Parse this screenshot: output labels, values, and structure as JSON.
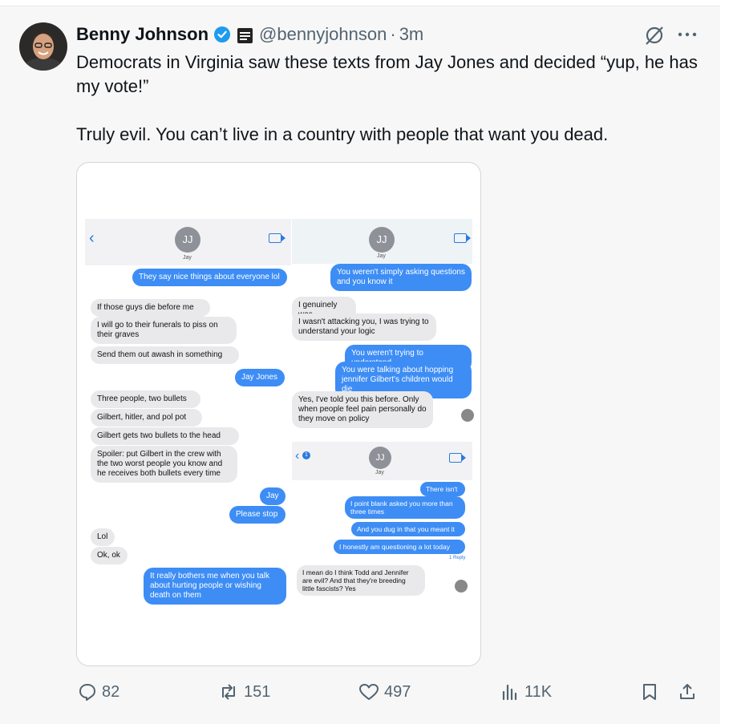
{
  "tweet": {
    "author_name": "Benny Johnson",
    "handle": "@bennyjohnson",
    "time": "3m",
    "dot": "·",
    "text_line1": "Democrats in Virginia saw these texts from Jay Jones and decided “yup, he has my vote!”",
    "text_line2": "Truly evil. You can’t live in a country with people that want you dead."
  },
  "media": {
    "left": {
      "contact_initials": "JJ",
      "contact_name": "Jay",
      "messages": [
        {
          "side": "me",
          "text": "They say nice things about everyone lol"
        },
        {
          "side": "them",
          "text": "If those guys die before me"
        },
        {
          "side": "them",
          "text": "I will go to their funerals to piss on their graves"
        },
        {
          "side": "them",
          "text": "Send them out awash in something"
        },
        {
          "side": "me",
          "text": "Jay Jones"
        },
        {
          "side": "them",
          "text": "Three people, two bullets"
        },
        {
          "side": "them",
          "text": "Gilbert, hitler, and pol pot"
        },
        {
          "side": "them",
          "text": "Gilbert gets two bullets to the head"
        },
        {
          "side": "them",
          "text": "Spoiler: put Gilbert in the crew with the two worst people you know and he receives both bullets every time"
        },
        {
          "side": "me",
          "text": "Jay"
        },
        {
          "side": "me",
          "text": "Please stop"
        },
        {
          "side": "them",
          "text": "Lol"
        },
        {
          "side": "them",
          "text": "Ok, ok"
        },
        {
          "side": "me",
          "text": "It really bothers me when you talk about hurting people or wishing death on them"
        }
      ]
    },
    "top_right": {
      "contact_initials": "JJ",
      "contact_name": "Jay",
      "messages": [
        {
          "side": "me",
          "text": "You weren't simply asking questions and you know it"
        },
        {
          "side": "them",
          "text": "I genuinely was"
        },
        {
          "side": "them",
          "text": "I wasn't attacking you, I was trying to understand your logic"
        },
        {
          "side": "me",
          "text": "You weren't trying to understand"
        },
        {
          "side": "me",
          "text": "You were talking about hopping jennifer Gilbert's children would die"
        },
        {
          "side": "them",
          "text": "Yes, I've told you this before. Only when people feel pain personally do they move on policy"
        }
      ]
    },
    "bottom_right": {
      "contact_initials": "JJ",
      "contact_name": "Jay",
      "back_count": "1",
      "messages": [
        {
          "side": "me",
          "text": "There isn't"
        },
        {
          "side": "me",
          "text": "I point blank asked you more than three times"
        },
        {
          "side": "me",
          "text": "And you dug in that you meant it"
        },
        {
          "side": "me",
          "text": "I honestly am questioning a lot today"
        },
        {
          "side": "them",
          "text": "I mean do I think Todd and Jennifer are evil? And that they're breeding little fascists? Yes"
        }
      ],
      "reply_label": "1 Reply"
    }
  },
  "actions": {
    "replies": "82",
    "reposts": "151",
    "likes": "497",
    "views": "11K"
  },
  "colors": {
    "verified": "#1d9bf0",
    "imessage_blue": "#3d8df5",
    "secondary_text": "#536471"
  },
  "icons": [
    "verified-badge-icon",
    "affiliate-badge-icon",
    "grok-icon",
    "more-icon",
    "reply-icon",
    "repost-icon",
    "like-icon",
    "views-icon",
    "bookmark-icon",
    "share-icon"
  ]
}
